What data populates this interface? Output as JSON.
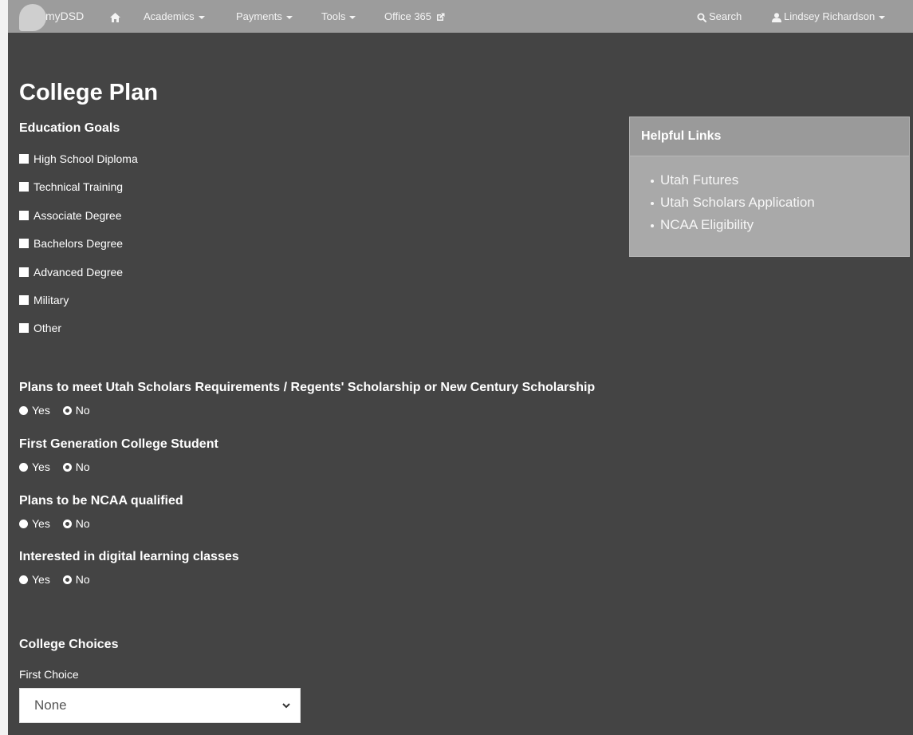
{
  "navbar": {
    "brand": "myDSD",
    "home_icon": "home-icon",
    "menus": [
      {
        "label": "Academics"
      },
      {
        "label": "Payments"
      },
      {
        "label": "Tools"
      }
    ],
    "office_label": "Office 365",
    "search_label": "Search",
    "user_label": "Lindsey Richardson"
  },
  "page": {
    "title": "College Plan"
  },
  "education_goals": {
    "title": "Education Goals",
    "items": [
      "High School Diploma",
      "Technical Training",
      "Associate Degree",
      "Bachelors Degree",
      "Advanced Degree",
      "Military",
      "Other"
    ]
  },
  "helpful_links": {
    "title": "Helpful Links",
    "items": [
      "Utah Futures",
      "Utah Scholars Application",
      "NCAA Eligibility"
    ]
  },
  "questions": [
    {
      "label": "Plans to meet Utah Scholars Requirements / Regents' Scholarship or New Century Scholarship",
      "yes": "Yes",
      "no": "No",
      "selected": "No"
    },
    {
      "label": "First Generation College Student",
      "yes": "Yes",
      "no": "No",
      "selected": "No"
    },
    {
      "label": "Plans to be NCAA qualified",
      "yes": "Yes",
      "no": "No",
      "selected": "No"
    },
    {
      "label": "Interested in digital learning classes",
      "yes": "Yes",
      "no": "No",
      "selected": "No"
    }
  ],
  "college_choices": {
    "title": "College Choices",
    "first_choice_label": "First Choice",
    "first_choice_value": "None"
  },
  "colors": {
    "background": "#444444",
    "navbar": "#9c9c9c",
    "panel": "#a9a9a9"
  }
}
